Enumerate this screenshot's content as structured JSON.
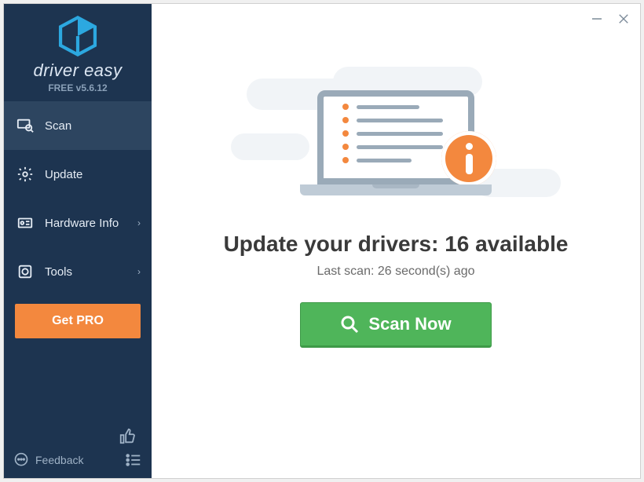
{
  "brand": {
    "name": "driver easy",
    "version": "FREE v5.6.12"
  },
  "nav": {
    "scan": "Scan",
    "update": "Update",
    "hardware": "Hardware Info",
    "tools": "Tools"
  },
  "getpro": "Get PRO",
  "footer": {
    "feedback": "Feedback"
  },
  "main": {
    "headline": "Update your drivers: 16 available",
    "subline": "Last scan: 26 second(s) ago",
    "scan_btn": "Scan Now"
  }
}
